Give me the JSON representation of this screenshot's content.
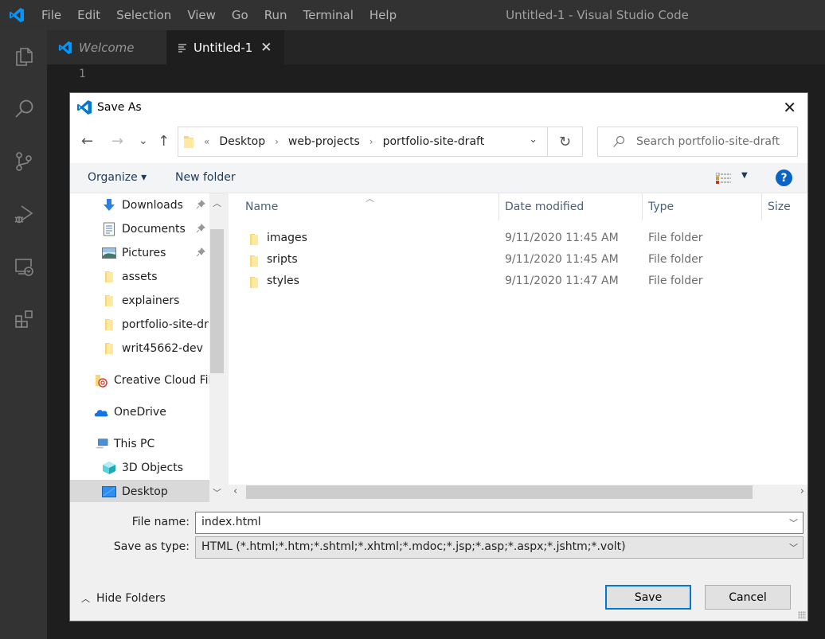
{
  "app": {
    "window_title": "Untitled-1 - Visual Studio Code",
    "menu": [
      "File",
      "Edit",
      "Selection",
      "View",
      "Go",
      "Run",
      "Terminal",
      "Help"
    ],
    "brand_color": "#0098ff"
  },
  "activity_bar": {
    "icons": [
      "explorer-icon",
      "search-icon",
      "source-control-icon",
      "run-debug-icon",
      "remote-explorer-icon",
      "extensions-icon"
    ]
  },
  "tabs": [
    {
      "label": "Welcome",
      "icon": "vscode-logo-icon",
      "active": false
    },
    {
      "label": "Untitled-1",
      "icon": "text-file-icon",
      "active": true,
      "close": "✕"
    }
  ],
  "editor": {
    "line_numbers": [
      "1"
    ]
  },
  "dialog": {
    "title": "Save As",
    "close_glyph": "✕",
    "nav": {
      "back": "←",
      "forward": "→",
      "recent": "⌄",
      "up": "↑"
    },
    "address": {
      "overflow": "«",
      "crumbs": [
        "Desktop",
        "web-projects",
        "portfolio-site-draft"
      ],
      "separator": "›"
    },
    "refresh_glyph": "↻",
    "search": {
      "placeholder": "Search portfolio-site-draft"
    },
    "toolbar": {
      "organize": "Organize ▾",
      "new_folder": "New folder",
      "help": "?"
    },
    "nav_pane": [
      {
        "label": "Downloads",
        "icon": "downloads-icon",
        "pinned": true
      },
      {
        "label": "Documents",
        "icon": "documents-icon",
        "pinned": true
      },
      {
        "label": "Pictures",
        "icon": "pictures-icon",
        "pinned": true
      },
      {
        "label": "assets",
        "icon": "folder-icon",
        "pinned": false
      },
      {
        "label": "explainers",
        "icon": "folder-icon",
        "pinned": false
      },
      {
        "label": "portfolio-site-dr",
        "icon": "folder-icon",
        "pinned": false
      },
      {
        "label": "writ45662-dev",
        "icon": "folder-icon",
        "pinned": false
      },
      {
        "label": "Creative Cloud File",
        "icon": "creative-cloud-icon",
        "pinned": false
      },
      {
        "label": "OneDrive",
        "icon": "onedrive-icon",
        "pinned": false
      },
      {
        "label": "This PC",
        "icon": "this-pc-icon",
        "pinned": false
      },
      {
        "label": "3D Objects",
        "icon": "3d-objects-icon",
        "pinned": false
      },
      {
        "label": "Desktop",
        "icon": "desktop-icon",
        "pinned": false,
        "selected": true
      }
    ],
    "columns": [
      "Name",
      "Date modified",
      "Type",
      "Size"
    ],
    "files": [
      {
        "name": "images",
        "date": "9/11/2020 11:45 AM",
        "type": "File folder",
        "size": ""
      },
      {
        "name": "sripts",
        "date": "9/11/2020 11:45 AM",
        "type": "File folder",
        "size": ""
      },
      {
        "name": "styles",
        "date": "9/11/2020 11:47 AM",
        "type": "File folder",
        "size": ""
      }
    ],
    "file_name_label": "File name:",
    "file_name_value": "index.html",
    "save_as_type_label": "Save as type:",
    "save_as_type_value": "HTML (*.html;*.htm;*.shtml;*.xhtml;*.mdoc;*.jsp;*.asp;*.aspx;*.jshtm;*.volt)",
    "hide_folders": "Hide Folders",
    "save_button": "Save",
    "cancel_button": "Cancel"
  }
}
